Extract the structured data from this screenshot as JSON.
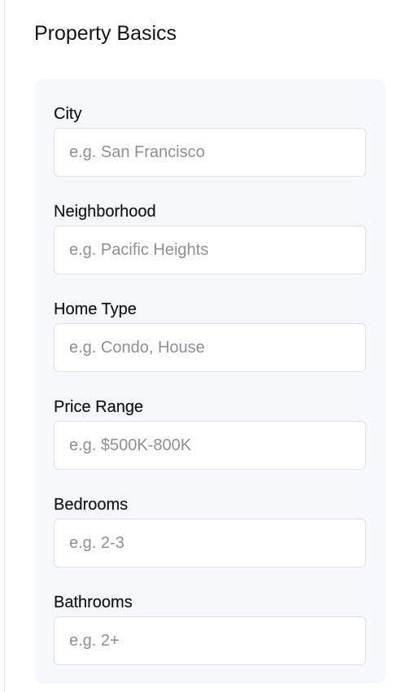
{
  "section": {
    "title": "Property Basics"
  },
  "form": {
    "fields": [
      {
        "label": "City",
        "value": "",
        "placeholder": "e.g. San Francisco"
      },
      {
        "label": "Neighborhood",
        "value": "",
        "placeholder": "e.g. Pacific Heights"
      },
      {
        "label": "Home Type",
        "value": "",
        "placeholder": "e.g. Condo, House"
      },
      {
        "label": "Price Range",
        "value": "",
        "placeholder": "e.g. $500K-800K"
      },
      {
        "label": "Bedrooms",
        "value": "",
        "placeholder": "e.g. 2-3"
      },
      {
        "label": "Bathrooms",
        "value": "",
        "placeholder": "e.g. 2+"
      }
    ]
  },
  "colors": {
    "page_background": "#ffffff",
    "card_background": "#f7f8fa",
    "input_border": "#dfe1e5",
    "placeholder_text": "#8d8f94",
    "label_text": "#161616"
  }
}
